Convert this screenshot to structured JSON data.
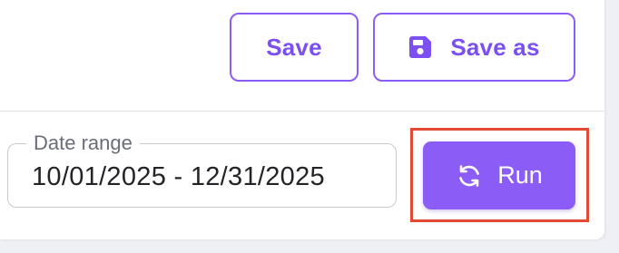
{
  "toolbar": {
    "save_label": "Save",
    "save_as_label": "Save as",
    "save_as_icon": "floppy-disk-icon"
  },
  "filters": {
    "date_range": {
      "label": "Date range",
      "value": "10/01/2025 - 12/31/2025"
    }
  },
  "actions": {
    "run_label": "Run",
    "run_icon": "refresh-icon"
  },
  "colors": {
    "accent": "#8b5cf6",
    "highlight": "#e24a33"
  }
}
